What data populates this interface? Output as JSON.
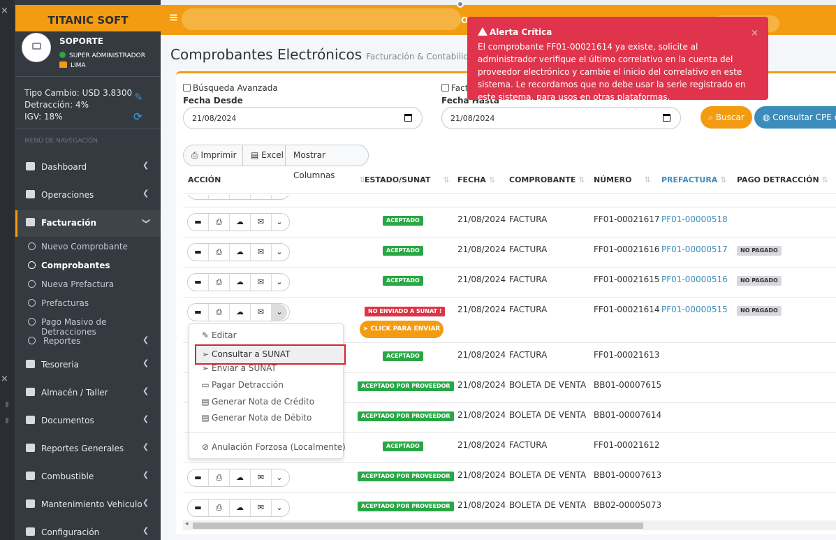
{
  "app": {
    "brand": "TITANIC SOFT"
  },
  "topbar": {
    "text": "O"
  },
  "user": {
    "name": "SOPORTE",
    "role": "SUPER ADMINISTRADOR",
    "location": "LIMA"
  },
  "rates": {
    "tipo_cambio": "Tipo Cambio: USD 3.8300",
    "detraccion": "Detracción: 4%",
    "igv": "IGV: 18%"
  },
  "nav": {
    "header": "MENÚ DE NAVEGACIÓN",
    "items": [
      {
        "label": "Dashboard",
        "icon": "dashboard-icon"
      },
      {
        "label": "Operaciones",
        "icon": "truck-icon"
      },
      {
        "label": "Facturación",
        "icon": "document-icon"
      },
      {
        "label": "Tesoreria",
        "icon": "money-icon"
      },
      {
        "label": "Almacén / Taller",
        "icon": "file-icon"
      },
      {
        "label": "Documentos",
        "icon": "book-icon"
      },
      {
        "label": "Reportes Generales",
        "icon": "chart-icon"
      },
      {
        "label": "Combustible",
        "icon": "chart-icon"
      },
      {
        "label": "Mantenimiento Vehiculo",
        "icon": "chart-icon"
      },
      {
        "label": "Configuración",
        "icon": "cogs-icon"
      }
    ],
    "sub": [
      {
        "label": "Nuevo Comprobante"
      },
      {
        "label": "Comprobantes"
      },
      {
        "label": "Nueva Prefactura"
      },
      {
        "label": "Prefacturas"
      },
      {
        "label": "Pago Masivo de Detracciones"
      },
      {
        "label": "Reportes"
      }
    ]
  },
  "page": {
    "title": "Comprobantes Electrónicos",
    "subtitle": "Facturación & Contabilidad"
  },
  "filters": {
    "advanced": "Búsqueda Avanzada",
    "fact_check": "Fact",
    "desde_label": "Fecha Desde",
    "desde_value": "21/08/2024",
    "hasta_label": "Fecha Hasta",
    "hasta_value": "21/08/2024",
    "buscar": "Buscar",
    "consultar_cpe": "Consultar CPE en"
  },
  "toolbar": {
    "imprimir": "Imprimir",
    "excel": "Excel",
    "columnas": "Mostrar Columnas"
  },
  "table": {
    "headers": [
      "ACCIÓN",
      "ESTADO/SUNAT",
      "FECHA",
      "COMPROBANTE",
      "NÚMERO",
      "PREFACTURA",
      "PAGO DETRACCIÓN"
    ],
    "rows": [
      {
        "estado": "ACEPTADO",
        "fecha": "21/08/2024",
        "comprobante": "FACTURA",
        "numero": "FF01-00021617",
        "prefactura": "PF01-00000518",
        "pago": ""
      },
      {
        "estado": "ACEPTADO",
        "fecha": "21/08/2024",
        "comprobante": "FACTURA",
        "numero": "FF01-00021616",
        "prefactura": "PF01-00000517",
        "pago": "NO PAGADO"
      },
      {
        "estado": "ACEPTADO",
        "fecha": "21/08/2024",
        "comprobante": "FACTURA",
        "numero": "FF01-00021615",
        "prefactura": "PF01-00000516",
        "pago": "NO PAGADO"
      },
      {
        "estado": "NO ENVIADO A SUNAT !",
        "fecha": "21/08/2024",
        "comprobante": "FACTURA",
        "numero": "FF01-00021614",
        "prefactura": "PF01-00000515",
        "pago": "NO PAGADO",
        "send": "CLICK PARA ENVIAR"
      },
      {
        "estado": "ACEPTADO",
        "fecha": "21/08/2024",
        "comprobante": "FACTURA",
        "numero": "FF01-00021613",
        "prefactura": "",
        "pago": ""
      },
      {
        "estado": "ACEPTADO POR PROVEEDOR",
        "fecha": "21/08/2024",
        "comprobante": "BOLETA DE VENTA",
        "numero": "BB01-00007615",
        "prefactura": "",
        "pago": ""
      },
      {
        "estado": "ACEPTADO POR PROVEEDOR",
        "fecha": "21/08/2024",
        "comprobante": "BOLETA DE VENTA",
        "numero": "BB01-00007614",
        "prefactura": "",
        "pago": ""
      },
      {
        "estado": "ACEPTADO",
        "fecha": "21/08/2024",
        "comprobante": "FACTURA",
        "numero": "FF01-00021612",
        "prefactura": "",
        "pago": ""
      },
      {
        "estado": "ACEPTADO POR PROVEEDOR",
        "fecha": "21/08/2024",
        "comprobante": "BOLETA DE VENTA",
        "numero": "BB01-00007613",
        "prefactura": "",
        "pago": ""
      },
      {
        "estado": "ACEPTADO POR PROVEEDOR",
        "fecha": "21/08/2024",
        "comprobante": "BOLETA DE VENTA",
        "numero": "BB02-00005073",
        "prefactura": "",
        "pago": ""
      }
    ]
  },
  "dropdown": {
    "items": [
      "Editar",
      "Consultar a SUNAT",
      "Enviar a SUNAT",
      "Pagar Detracción",
      "Generar Nota de Crédito",
      "Generar Nota de Débito",
      "Anulación Forzosa (Localmente)"
    ]
  },
  "alert": {
    "title": "Alerta Crítica",
    "message": "El comprobante FF01-00021614 ya existe, solicite al administrador verifique el último correlativo en la cuenta del proveedor electrónico y cambie el inicio del correlativo en este sistema. Le recordamos que no debe usar la serie registrado en este sistema, para usos en otras plataformas.",
    "close": "×"
  },
  "colors": {
    "accent": "#f39c12",
    "sidebar": "#343a40",
    "link": "#3c8dbc",
    "success": "#28a745",
    "danger": "#dc3545",
    "alert": "#e0344d"
  }
}
